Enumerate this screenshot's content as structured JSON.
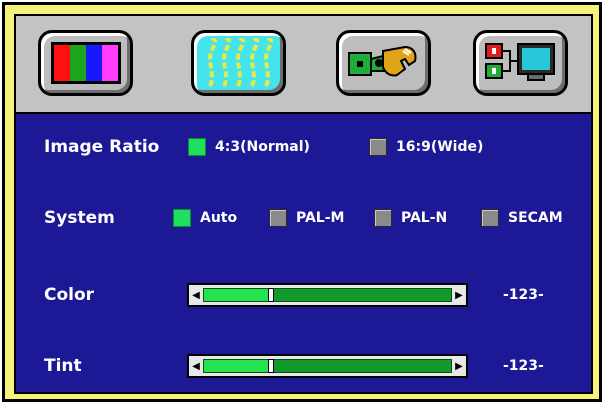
{
  "tabs": [
    {
      "icon": "color-bars-icon",
      "active": false
    },
    {
      "icon": "picture-waves-icon",
      "active": true
    },
    {
      "icon": "wrench-settings-icon",
      "active": false
    },
    {
      "icon": "input-source-monitor-icon",
      "active": false
    }
  ],
  "image_ratio": {
    "label": "Image Ratio",
    "options": [
      {
        "label": "4:3(Normal)",
        "selected": true
      },
      {
        "label": "16:9(Wide)",
        "selected": false
      }
    ]
  },
  "system": {
    "label": "System",
    "options": [
      {
        "label": "Auto",
        "selected": true
      },
      {
        "label": "PAL-M",
        "selected": false
      },
      {
        "label": "PAL-N",
        "selected": false
      },
      {
        "label": "SECAM",
        "selected": false
      }
    ]
  },
  "color": {
    "label": "Color",
    "value_text": "-123-",
    "level": 0.27
  },
  "tint": {
    "label": "Tint",
    "value_text": "-123-",
    "level": 0.27
  },
  "colors": {
    "frame": "#f5f37a",
    "panel": "#1c1896",
    "active_tab": "#45e3ea",
    "selected_box": "#1fe05c",
    "slider_fill": "#25e34e",
    "slider_trough": "#129a2a"
  }
}
